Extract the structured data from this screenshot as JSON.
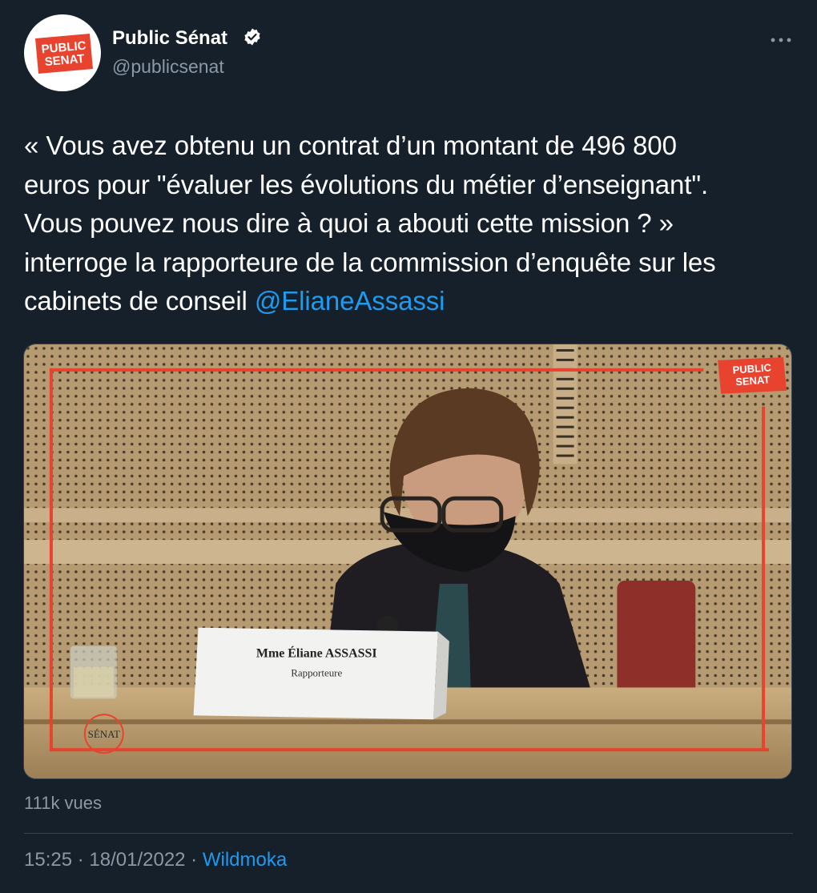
{
  "author": {
    "name": "Public Sénat",
    "handle": "@publicsenat",
    "avatar_text": "PUBLIC SENAT",
    "verified": true
  },
  "tweet": {
    "text_lines": [
      "« Vous avez obtenu un contrat d’un montant de 496 800",
      "euros pour \"évaluer les évolutions du métier d’enseignant\".",
      "Vous pouvez nous dire à quoi a abouti cette mission ? »",
      "interroge la rapporteure de la commission d’enquête sur les",
      "cabinets de conseil "
    ],
    "mention": "@ElianeAssassi"
  },
  "media": {
    "logo_line1": "PUBLIC",
    "logo_line2": "SENAT",
    "nameplate_name": "Mme Éliane ASSASSI",
    "nameplate_role": "Rapporteure",
    "senat_mark": "SÉNAT"
  },
  "stats": {
    "views": "111k vues"
  },
  "meta": {
    "time": "15:25",
    "separator": " · ",
    "date": "18/01/2022",
    "source": "Wildmoka"
  },
  "colors": {
    "background": "#15202b",
    "link": "#1d9bf0",
    "secondary_text": "#8b98a5",
    "brand_red": "#e8432e"
  },
  "icons": [
    "verified-badge-icon",
    "more-options-icon"
  ]
}
